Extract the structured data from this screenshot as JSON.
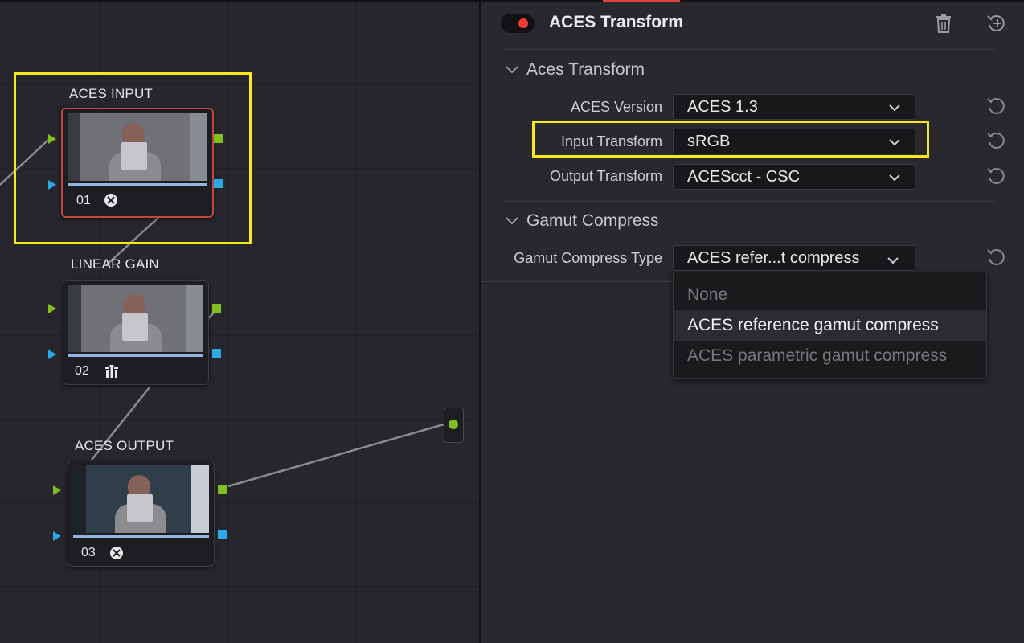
{
  "node_editor": {
    "nodes": [
      {
        "label": "ACES INPUT",
        "number": "01",
        "icon": "aces-transform-icon"
      },
      {
        "label": "LINEAR GAIN",
        "number": "02",
        "icon": "gain-bars-icon"
      },
      {
        "label": "ACES OUTPUT",
        "number": "03",
        "icon": "aces-transform-icon"
      }
    ]
  },
  "inspector": {
    "title": "ACES Transform",
    "enabled": true,
    "sections": {
      "aces_transform": {
        "title": "Aces Transform",
        "rows": [
          {
            "label": "ACES Version",
            "value": "ACES 1.3"
          },
          {
            "label": "Input Transform",
            "value": "sRGB"
          },
          {
            "label": "Output Transform",
            "value": "ACEScct - CSC"
          }
        ]
      },
      "gamut_compress": {
        "title": "Gamut Compress",
        "rows": [
          {
            "label": "Gamut Compress Type",
            "value": "ACES refer...t compress"
          }
        ]
      }
    },
    "dropdown_menu": {
      "options": [
        "None",
        "ACES reference gamut compress",
        "ACES parametric gamut compress"
      ],
      "highlighted": "ACES reference gamut compress"
    }
  },
  "colors": {
    "accent_red": "#e0453a",
    "highlight_yellow": "#f5ea1e",
    "port_green": "#7fbf1f",
    "port_blue": "#2aa8e8"
  }
}
